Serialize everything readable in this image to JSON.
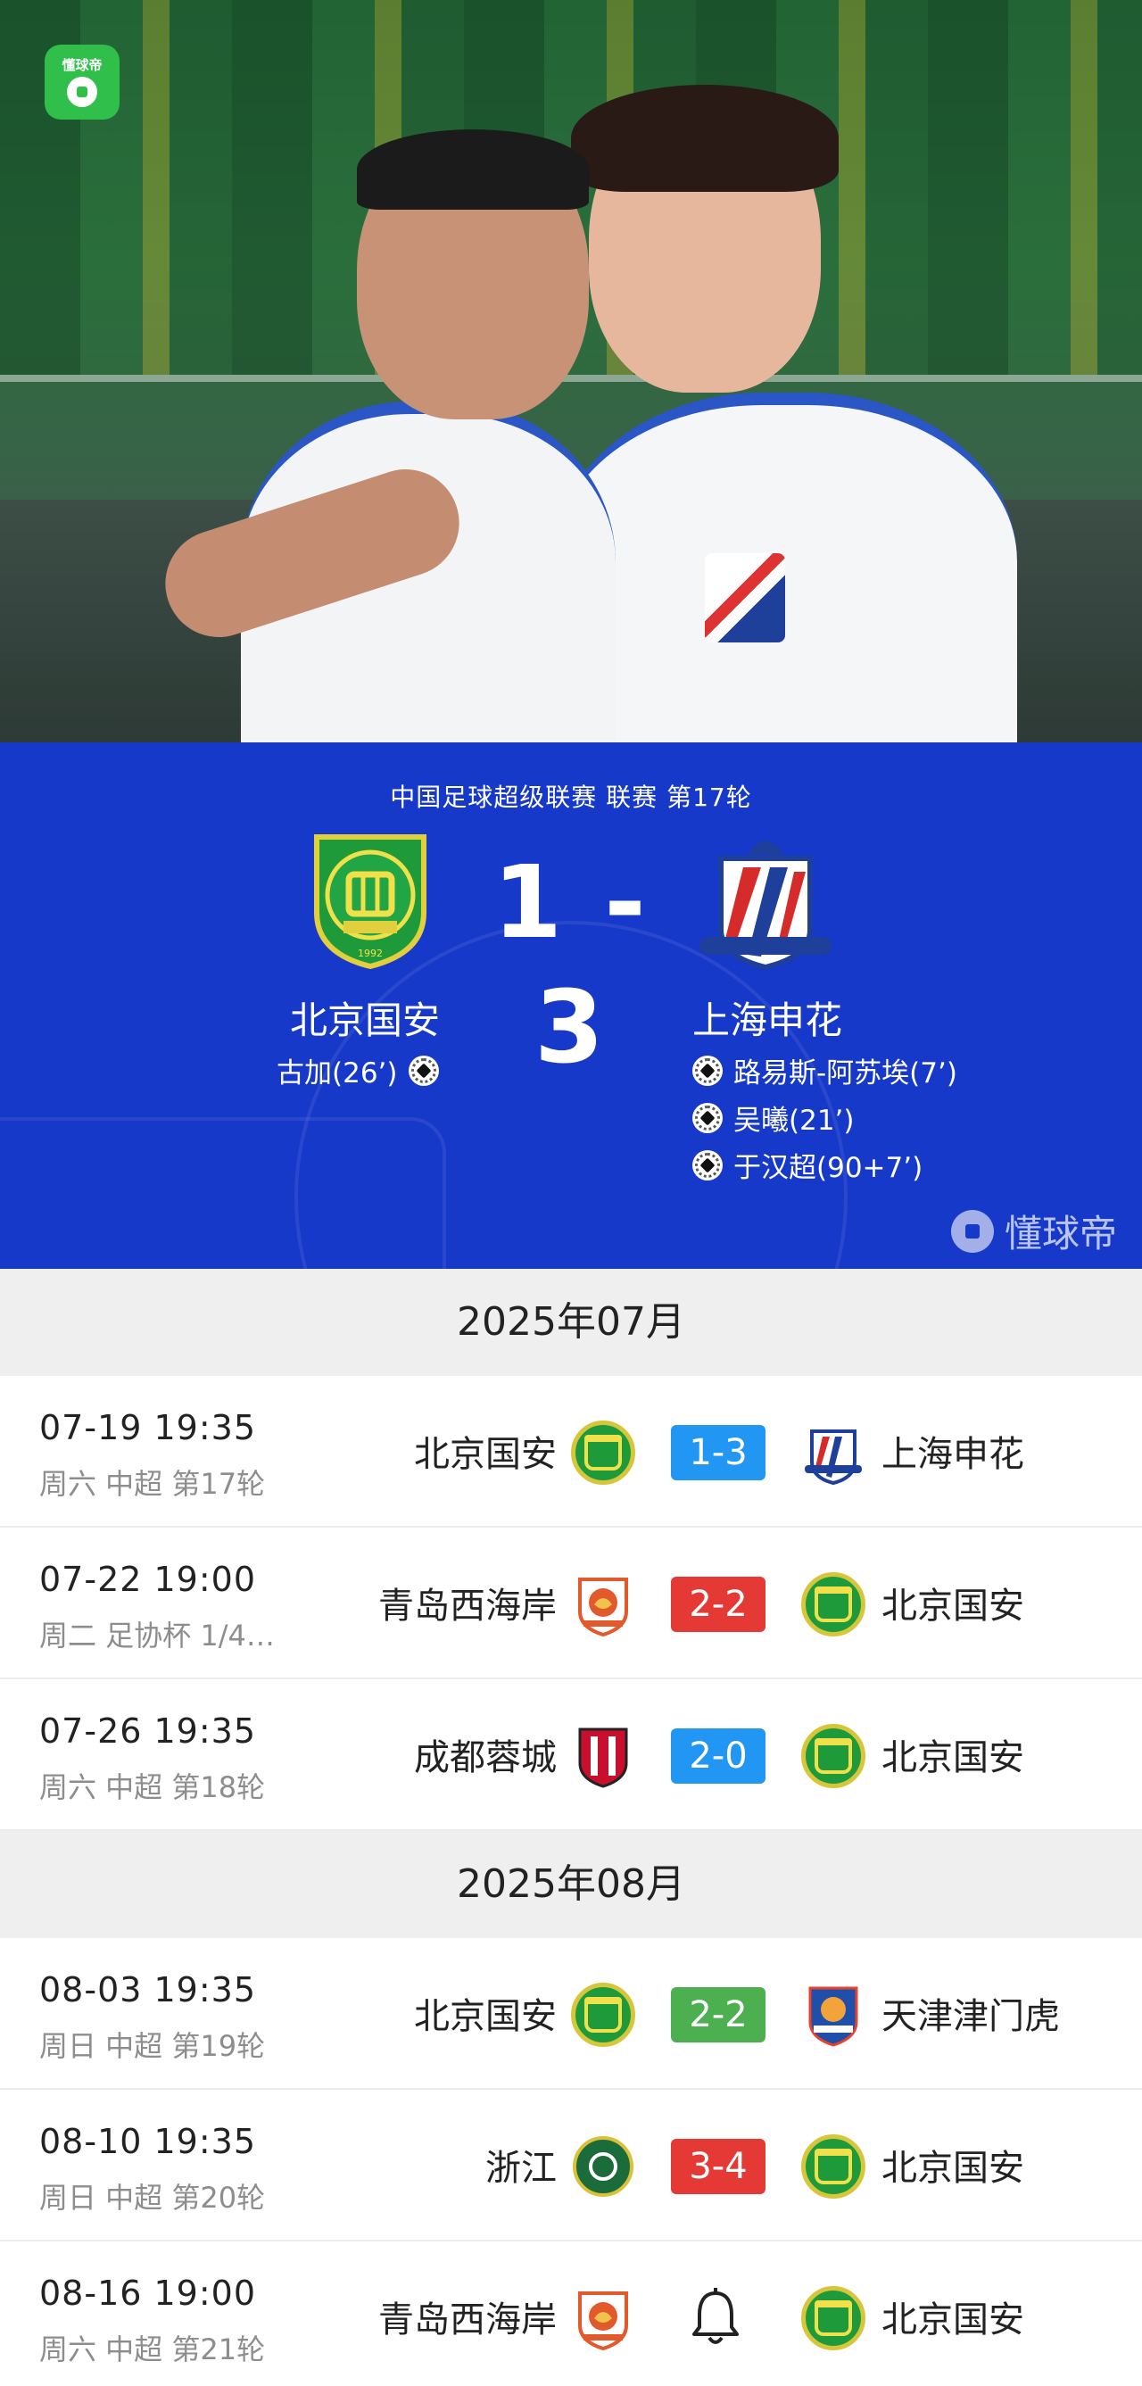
{
  "app": {
    "logo_text": "懂球帝"
  },
  "match": {
    "competition": "中国足球超级联赛 联赛 第17轮",
    "score": "1 - 3",
    "home": {
      "name": "北京国安",
      "color": "#1f9a3a",
      "scorers": [
        "古加(26’)"
      ]
    },
    "away": {
      "name": "上海申花",
      "color": "#2a56c6",
      "scorers": [
        "路易斯-阿苏埃(7’)",
        "吴曦(21’)",
        "于汉超(90+7’)"
      ]
    },
    "watermark": "懂球帝",
    "panel_color": "#1739c9"
  },
  "months": [
    {
      "label": "2025年07月",
      "matches": [
        {
          "time": "07-19 19:35",
          "meta": "周六 中超 第17轮",
          "home": "北京国安",
          "home_crest": "guoan-crest-icon",
          "score": "1-3",
          "score_color": "#2196f3",
          "away": "上海申花",
          "away_crest": "shenhua-crest-icon"
        },
        {
          "time": "07-22 19:00",
          "meta": "周二 足协杯 1/4…",
          "home": "青岛西海岸",
          "home_crest": "qingdao-crest-icon",
          "score": "2-2",
          "score_color": "#e53935",
          "away": "北京国安",
          "away_crest": "guoan-crest-icon"
        },
        {
          "time": "07-26 19:35",
          "meta": "周六 中超 第18轮",
          "home": "成都蓉城",
          "home_crest": "chengdu-crest-icon",
          "score": "2-0",
          "score_color": "#2196f3",
          "away": "北京国安",
          "away_crest": "guoan-crest-icon"
        }
      ]
    },
    {
      "label": "2025年08月",
      "matches": [
        {
          "time": "08-03 19:35",
          "meta": "周日 中超 第19轮",
          "home": "北京国安",
          "home_crest": "guoan-crest-icon",
          "score": "2-2",
          "score_color": "#4caf50",
          "away": "天津津门虎",
          "away_crest": "tianjin-crest-icon"
        },
        {
          "time": "08-10 19:35",
          "meta": "周日 中超 第20轮",
          "home": "浙江",
          "home_crest": "zhejiang-crest-icon",
          "score": "3-4",
          "score_color": "#e53935",
          "away": "北京国安",
          "away_crest": "guoan-crest-icon"
        },
        {
          "time": "08-16 19:00",
          "meta": "周六 中超 第21轮",
          "home": "青岛西海岸",
          "home_crest": "qingdao-crest-icon",
          "score": null,
          "status_icon": "bell-icon",
          "away": "北京国安",
          "away_crest": "guoan-crest-icon"
        }
      ]
    }
  ]
}
